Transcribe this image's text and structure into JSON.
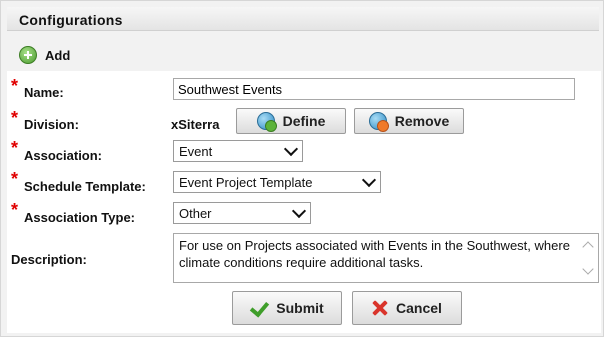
{
  "panel": {
    "title": "Configurations"
  },
  "toolbar": {
    "add_label": "Add"
  },
  "form": {
    "name": {
      "label": "Name:",
      "value": "Southwest Events"
    },
    "division": {
      "label": "Division:",
      "value": "xSiterra",
      "define_label": "Define",
      "remove_label": "Remove"
    },
    "association": {
      "label": "Association:",
      "value": "Event"
    },
    "schedule_template": {
      "label": "Schedule Template:",
      "value": "Event Project Template"
    },
    "association_type": {
      "label": "Association Type:",
      "value": "Other"
    },
    "description": {
      "label": "Description:",
      "value": "For use on Projects associated with Events in the Southwest, where climate conditions require additional tasks."
    },
    "required_marker": "*"
  },
  "actions": {
    "submit_label": "Submit",
    "cancel_label": "Cancel"
  },
  "colors": {
    "required": "#e00000",
    "submit_check": "#3f9e2a",
    "cancel_x": "#d9342b"
  },
  "icons": {
    "add": "add-circle-icon",
    "define": "globe-add-icon",
    "remove": "globe-remove-icon",
    "submit": "checkmark-icon",
    "cancel": "x-icon"
  }
}
